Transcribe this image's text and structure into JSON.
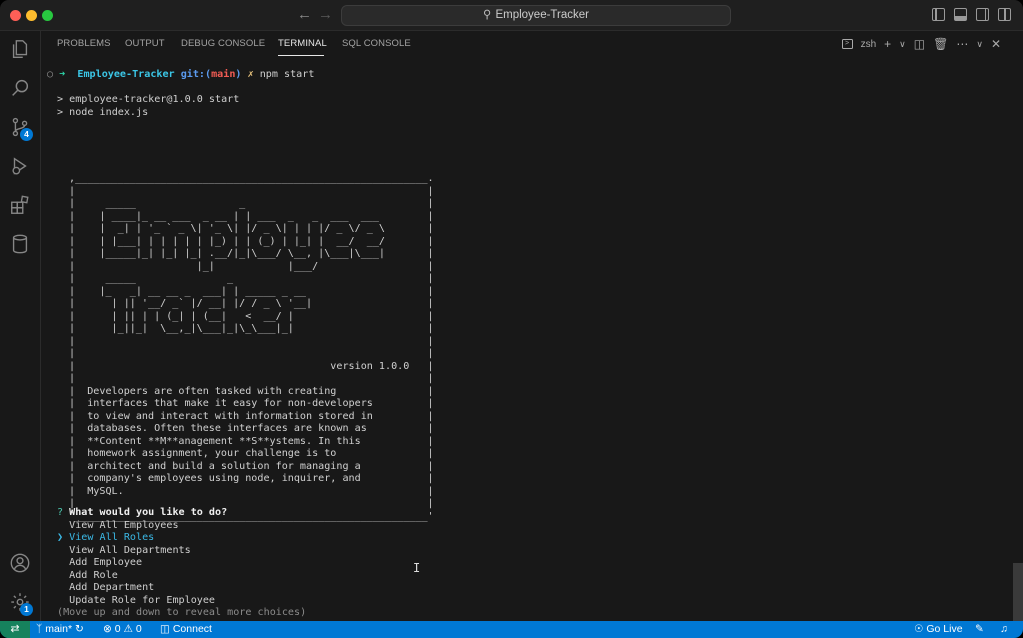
{
  "window": {
    "title": "Employee-Tracker",
    "accent_color": "#0078d4"
  },
  "activity_bar": {
    "items": [
      {
        "name": "explorer",
        "icon": "files-icon"
      },
      {
        "name": "search",
        "icon": "search-icon"
      },
      {
        "name": "source-control",
        "icon": "source-control-icon",
        "badge": "4"
      },
      {
        "name": "run-debug",
        "icon": "run-debug-icon"
      },
      {
        "name": "extensions",
        "icon": "extensions-icon"
      },
      {
        "name": "database",
        "icon": "database-icon"
      }
    ],
    "bottom": [
      {
        "name": "accounts",
        "icon": "account-icon"
      },
      {
        "name": "manage",
        "icon": "gear-icon",
        "badge": "1"
      }
    ]
  },
  "panel": {
    "tabs": [
      "PROBLEMS",
      "OUTPUT",
      "DEBUG CONSOLE",
      "TERMINAL",
      "SQL CONSOLE"
    ],
    "active_tab": "TERMINAL",
    "shell": "zsh"
  },
  "terminal": {
    "prompt": {
      "dir": "Employee-Tracker",
      "git_prefix": "git:(",
      "branch": "main",
      "git_suffix": ")",
      "dirty": "✗",
      "command": "npm start"
    },
    "npm_lines": [
      "> employee-tracker@1.0.0 start",
      "> node index.js"
    ],
    "banner": [
      ",__________________________________________________________.",
      "|                                                          |",
      "|     _____                 _                              |",
      "|    | ____|_ __ ___  _ __ | | ___  _   _  ___  ___        |",
      "|    |  _| | '_ ` _ \\| '_ \\| |/ _ \\| | | |/ _ \\/ _ \\       |",
      "|    | |___| | | | | | |_) | | (_) | |_| |  __/  __/       |",
      "|    |_____|_| |_| |_| .__/|_|\\___/ \\__, |\\___|\\___|       |",
      "|                    |_|            |___/                  |",
      "|     _____               _                                |",
      "|    |_   _| __ __ _  ___| | _____ _ __                    |",
      "|      | || '__/ _` |/ __| |/ / _ \\ '__|                   |",
      "|      | || | | (_| | (__|   <  __/ |                      |",
      "|      |_||_|  \\__,_|\\___|_|\\_\\___|_|                      |",
      "|                                                          |",
      "|                                                          |",
      "|                                          version 1.0.0   |",
      "|                                                          |",
      "|  Developers are often tasked with creating               |",
      "|  interfaces that make it easy for non-developers         |",
      "|  to view and interact with information stored in         |",
      "|  databases. Often these interfaces are known as          |",
      "|  **Content **M**anagement **S**ystems. In this           |",
      "|  homework assignment, your challenge is to               |",
      "|  architect and build a solution for managing a           |",
      "|  company's employees using node, inquirer, and           |",
      "|  MySQL.                                                  |",
      "|                                                          |",
      "`__________________________________________________________'"
    ],
    "question_mark": "?",
    "question": "What would you like to do?",
    "selected_pointer": "❯",
    "choices": [
      "View All Employees",
      "View All Roles",
      "View All Departments",
      "Add Employee",
      "Add Role",
      "Add Department",
      "Update Role for Employee"
    ],
    "selected_index": 1,
    "hint": "(Move up and down to reveal more choices)"
  },
  "statusbar": {
    "branch": "main*",
    "errors": "0",
    "warnings": "0",
    "connect": "Connect",
    "go_live": "Go Live"
  }
}
